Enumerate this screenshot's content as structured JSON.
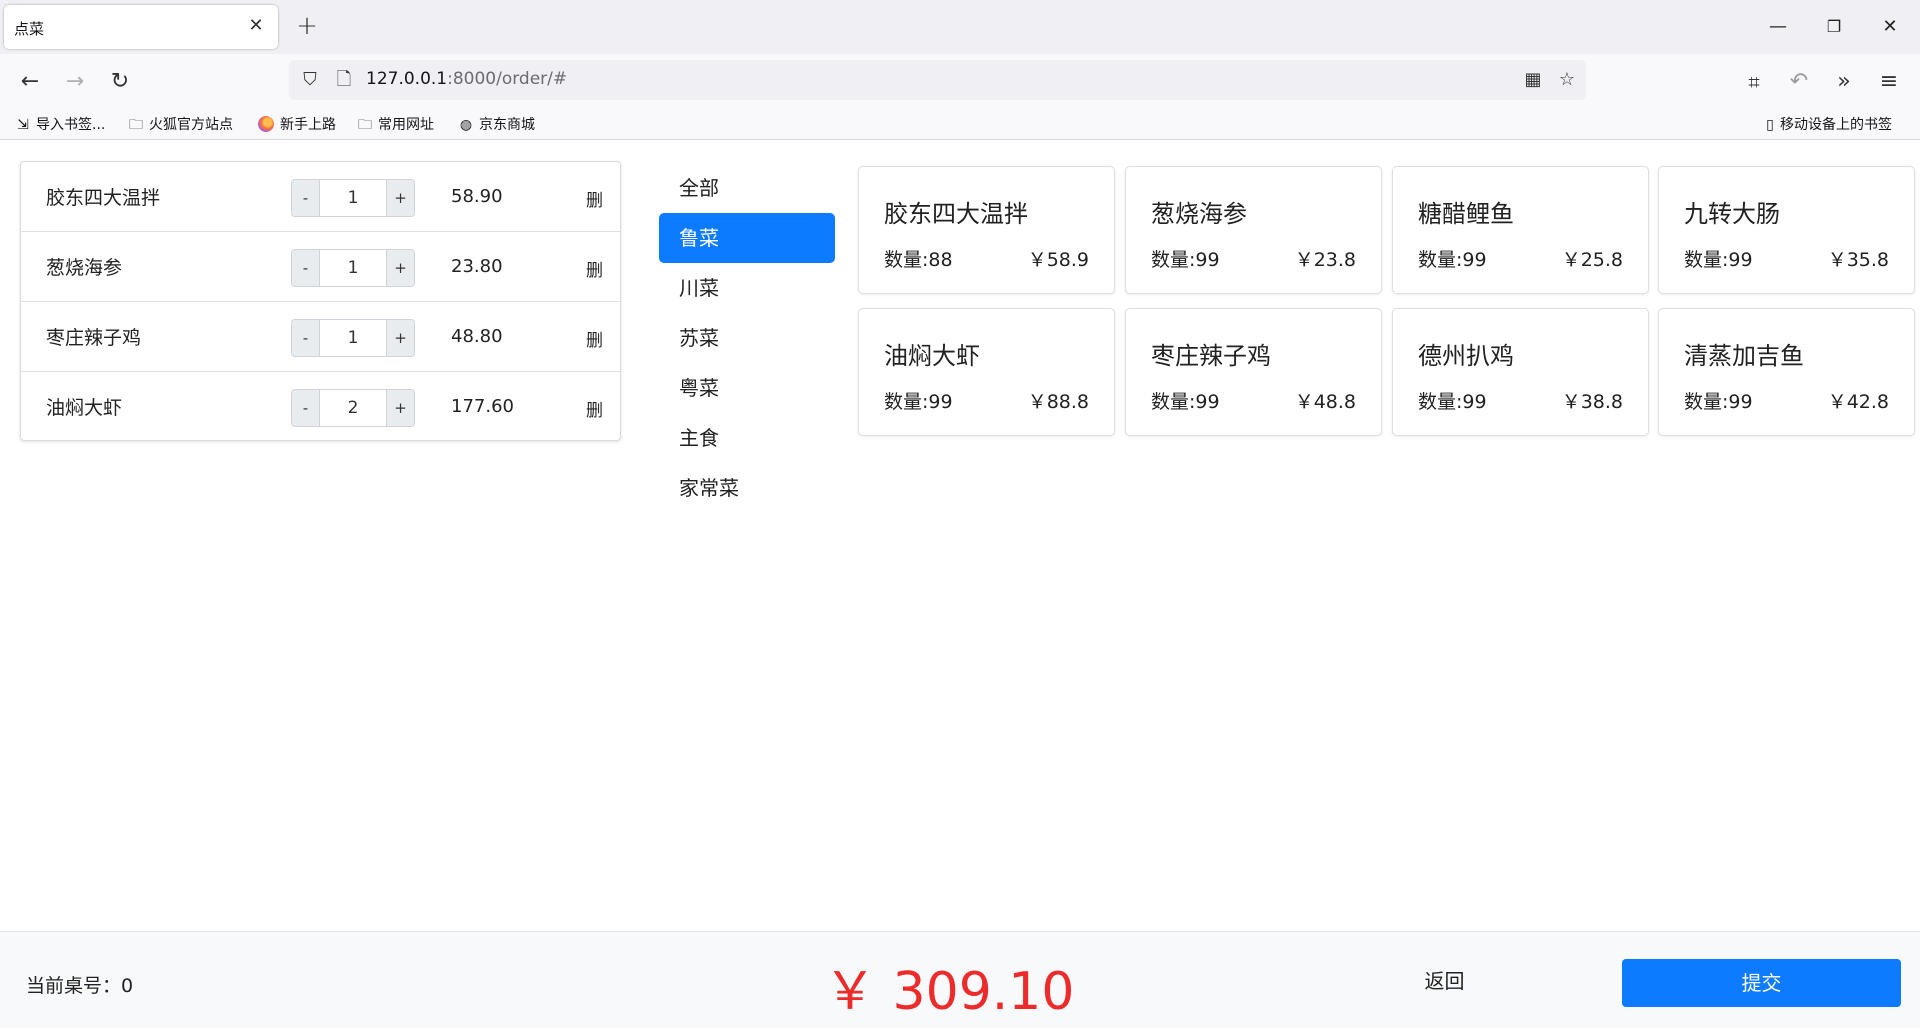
{
  "browser": {
    "tab_title": "点菜",
    "url_host": "127.0.0.1",
    "url_rest": ":8000/order/#",
    "bookmarks": [
      "导入书签...",
      "火狐官方站点",
      "新手上路",
      "常用网址",
      "京东商城"
    ],
    "mobile_bookmarks": "移动设备上的书签"
  },
  "cart": [
    {
      "name": "胶东四大温拌",
      "qty": "1",
      "price": "58.90",
      "delete": "删"
    },
    {
      "name": "葱烧海参",
      "qty": "1",
      "price": "23.80",
      "delete": "删"
    },
    {
      "name": "枣庄辣子鸡",
      "qty": "1",
      "price": "48.80",
      "delete": "删"
    },
    {
      "name": "油焖大虾",
      "qty": "2",
      "price": "177.60",
      "delete": "删"
    }
  ],
  "stepper": {
    "minus": "-",
    "plus": "+"
  },
  "categories": [
    {
      "label": "全部",
      "active": false
    },
    {
      "label": "鲁菜",
      "active": true
    },
    {
      "label": "川菜",
      "active": false
    },
    {
      "label": "苏菜",
      "active": false
    },
    {
      "label": "粤菜",
      "active": false
    },
    {
      "label": "主食",
      "active": false
    },
    {
      "label": "家常菜",
      "active": false
    }
  ],
  "dishes": [
    {
      "name": "胶东四大温拌",
      "stock": "数量:88",
      "price": "￥58.9"
    },
    {
      "name": "葱烧海参",
      "stock": "数量:99",
      "price": "￥23.8"
    },
    {
      "name": "糖醋鲤鱼",
      "stock": "数量:99",
      "price": "￥25.8"
    },
    {
      "name": "九转大肠",
      "stock": "数量:99",
      "price": "￥35.8"
    },
    {
      "name": "油焖大虾",
      "stock": "数量:99",
      "price": "￥88.8"
    },
    {
      "name": "枣庄辣子鸡",
      "stock": "数量:99",
      "price": "￥48.8"
    },
    {
      "name": "德州扒鸡",
      "stock": "数量:99",
      "price": "￥38.8"
    },
    {
      "name": "清蒸加吉鱼",
      "stock": "数量:99",
      "price": "￥42.8"
    }
  ],
  "footer": {
    "table_no": "当前桌号：0",
    "total": "￥ 309.10",
    "back": "返回",
    "submit": "提交"
  },
  "colors": {
    "primary": "#0d7bff",
    "total": "#ee2b2b"
  }
}
